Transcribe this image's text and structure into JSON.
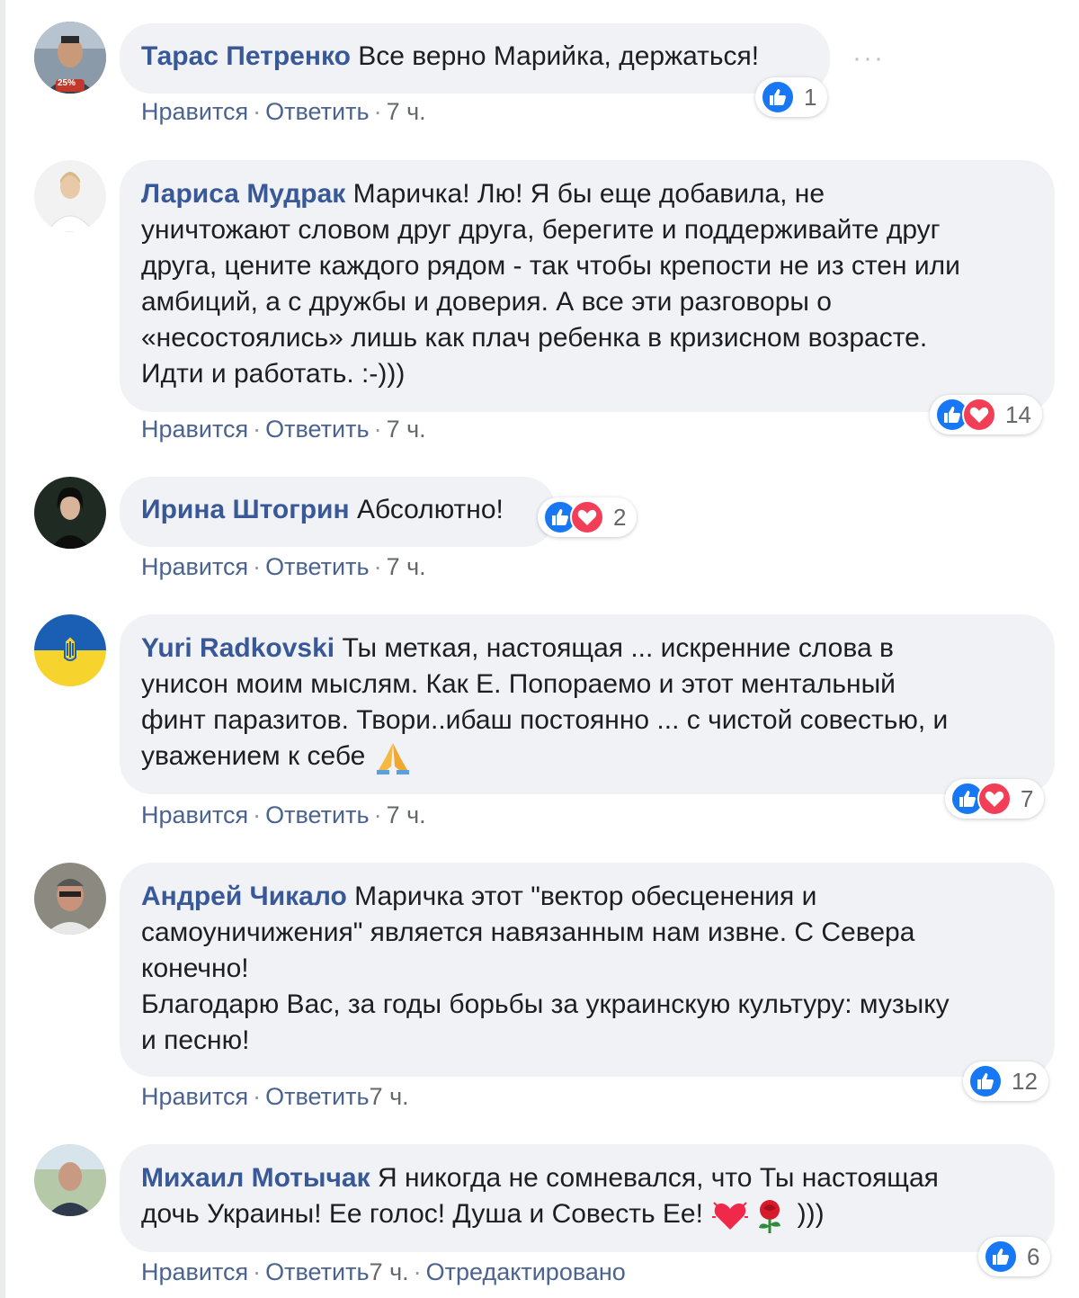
{
  "actions": {
    "like": "Нравится",
    "reply": "Ответить",
    "sep": "·",
    "edited": "Отредактировано"
  },
  "more_label": "···",
  "comments": [
    {
      "author": "Тарас Петренко",
      "text": "Все верно Марийка, держаться!",
      "time": "7 ч.",
      "reactions": [
        "like"
      ],
      "count": "1",
      "avatar_badge": "25%"
    },
    {
      "author": "Лариса Мудрак",
      "text": "Маричка! Лю! Я бы еще добавила, не\nуничтожают словом друг друга, берегите и поддерживайте друг\nдруга, цените каждого рядом - так чтобы крепости не из стен или\nамбиций, а с дружбы и доверия. А все эти разговоры о\n«несостоялись» лишь как плач ребенка в кризисном возрасте.\nИдти и работать. :-)))",
      "time": "7 ч.",
      "reactions": [
        "like",
        "love"
      ],
      "count": "14"
    },
    {
      "author": "Ирина Штогрин",
      "text": "Абсолютно!",
      "time": "7 ч.",
      "reactions": [
        "like",
        "love"
      ],
      "count": "2"
    },
    {
      "author": "Yuri Radkovski",
      "text": "Ты меткая, настоящая ... искренние слова в\nунисон моим мыслям. Как Е. Попораемо и этот ментальный\nфинт паразитов. Твори..ибаш постоянно ... с чистой совестью, и\nуважением к себе ",
      "time": "7 ч.",
      "reactions": [
        "like",
        "love"
      ],
      "count": "7",
      "trailing_emoji": "folded-hands"
    },
    {
      "author": "Андрей Чикало",
      "text": "Маричка этот \"вектор обесценения и\nсамоуничижения\" является навязанным нам извне. С Севера\nконечно!\nБлагодарю Вас, за годы борьбы за украинскую культуру: музыку\nи песню!",
      "time": "7 ч.",
      "reactions": [
        "like"
      ],
      "count": "12"
    },
    {
      "author": "Михаил Мотычак",
      "text": "Я никогда не сомневался, что Ты настоящая\nдочь Украины! Ее голос! Душа и Совесть Ее! ",
      "text_after": " )))",
      "time": "7 ч.",
      "reactions": [
        "like"
      ],
      "count": "6",
      "edited": true
    }
  ]
}
